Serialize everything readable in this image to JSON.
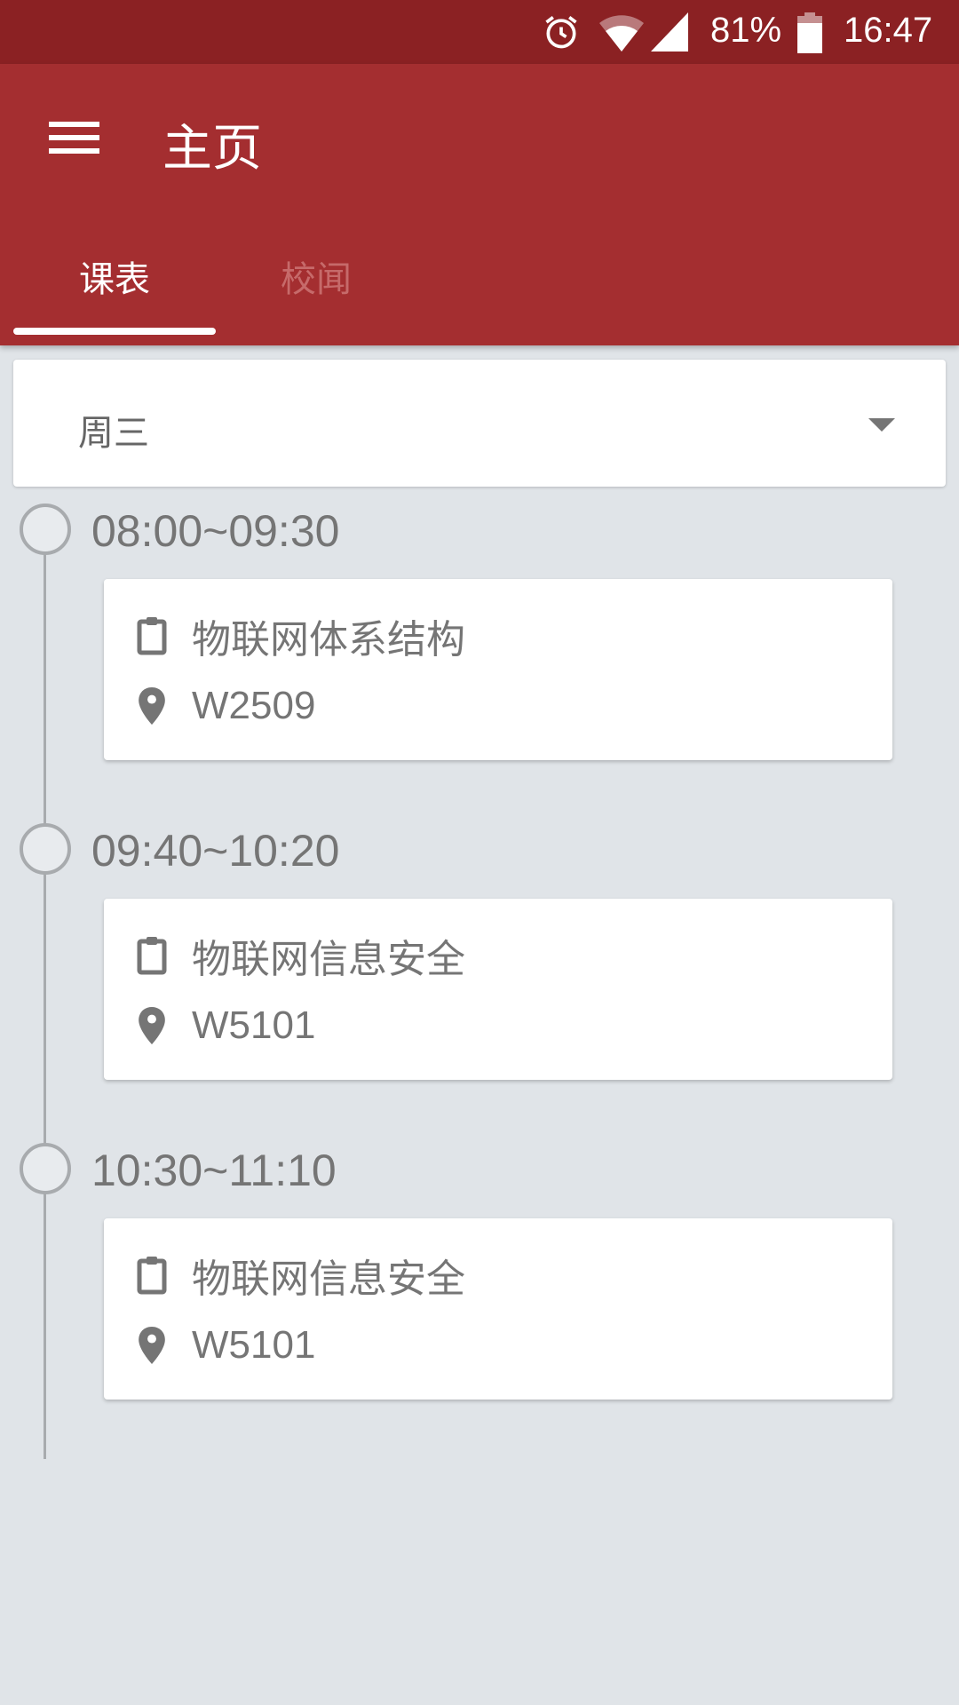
{
  "status_bar": {
    "battery": "81%",
    "time": "16:47",
    "icons": [
      "alarm-icon",
      "wifi-icon",
      "signal-icon",
      "battery-icon"
    ]
  },
  "toolbar": {
    "title": "主页"
  },
  "tabs": [
    {
      "label": "课表",
      "active": true
    },
    {
      "label": "校闻",
      "active": false
    }
  ],
  "day_selector": {
    "value": "周三"
  },
  "schedule": [
    {
      "time": "08:00~09:30",
      "course": "物联网体系结构",
      "room": "W2509"
    },
    {
      "time": "09:40~10:20",
      "course": "物联网信息安全",
      "room": "W5101"
    },
    {
      "time": "10:30~11:10",
      "course": "物联网信息安全",
      "room": "W5101"
    }
  ],
  "colors": {
    "status_bar": "#8b2123",
    "primary": "#a42e30",
    "background": "#e0e4e8"
  }
}
